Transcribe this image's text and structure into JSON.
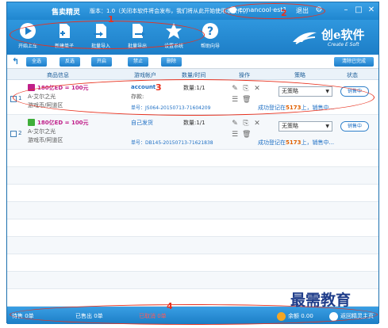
{
  "titlebar": {
    "app_title": "售卖精灵",
    "version": "版本：1.0（关闭本软件将会发布，我们将从此开始使用本软件。）",
    "user": "conancool·est1",
    "logout": "退出"
  },
  "toolbar": {
    "items": [
      {
        "label": "开始上车",
        "icon": "play-icon"
      },
      {
        "label": "新建单子",
        "icon": "new-doc-icon"
      },
      {
        "label": "批量导入",
        "icon": "import-icon"
      },
      {
        "label": "批量导出",
        "icon": "export-icon"
      },
      {
        "label": "设置系统",
        "icon": "settings-star-icon"
      },
      {
        "label": "帮助向导",
        "icon": "help-icon"
      }
    ]
  },
  "brand": {
    "name": "创e软件",
    "sub": "Create E Soft"
  },
  "actions": {
    "select_all": "全选",
    "invert": "反选",
    "enable": "开启",
    "disable": "禁止",
    "delete": "删除",
    "clear_done": "清除已完成"
  },
  "columns": {
    "goods": "商品信息",
    "account": "游戏帐户",
    "qty_time": "数量/时间",
    "ops": "操作",
    "strategy": "策略",
    "state": "状态"
  },
  "rows": [
    {
      "index": "1",
      "name": "180亿ED = 100元",
      "line2": "A-艾尔之光",
      "line3": "游戏币/阿道区",
      "account": "account",
      "stock": "存款:",
      "order": "单号：JS064-20150713-71604209",
      "qty": "数量:1/1",
      "strategy": "无策略",
      "state": "销售中",
      "log_prefix": "成功登记在",
      "log_num": "5173",
      "log_suffix": "上，销售中..."
    },
    {
      "index": "2",
      "name": "180亿ED = 100元",
      "line2": "A-艾尔之光",
      "line3": "游戏币/阿道区",
      "account": "自己发货",
      "stock": "",
      "order": "单号：DB145-20150713-71621838",
      "qty": "数量:1/1",
      "strategy": "无策略",
      "state": "销售中",
      "log_prefix": "成功登记在",
      "log_num": "5173",
      "log_suffix": "上，销售中..."
    }
  ],
  "statusbar": {
    "waiting": "待售 0单",
    "sold": "已售出 0单",
    "failed": "已取消 0单",
    "balance": "余额 0.00",
    "home": "返回精灵主页"
  },
  "annotations": [
    "1",
    "2",
    "3",
    "4"
  ],
  "watermark": "最需教育",
  "colors": {
    "accent": "#1e7fca",
    "annotation": "#e8321f",
    "product_name": "#c0208a"
  }
}
